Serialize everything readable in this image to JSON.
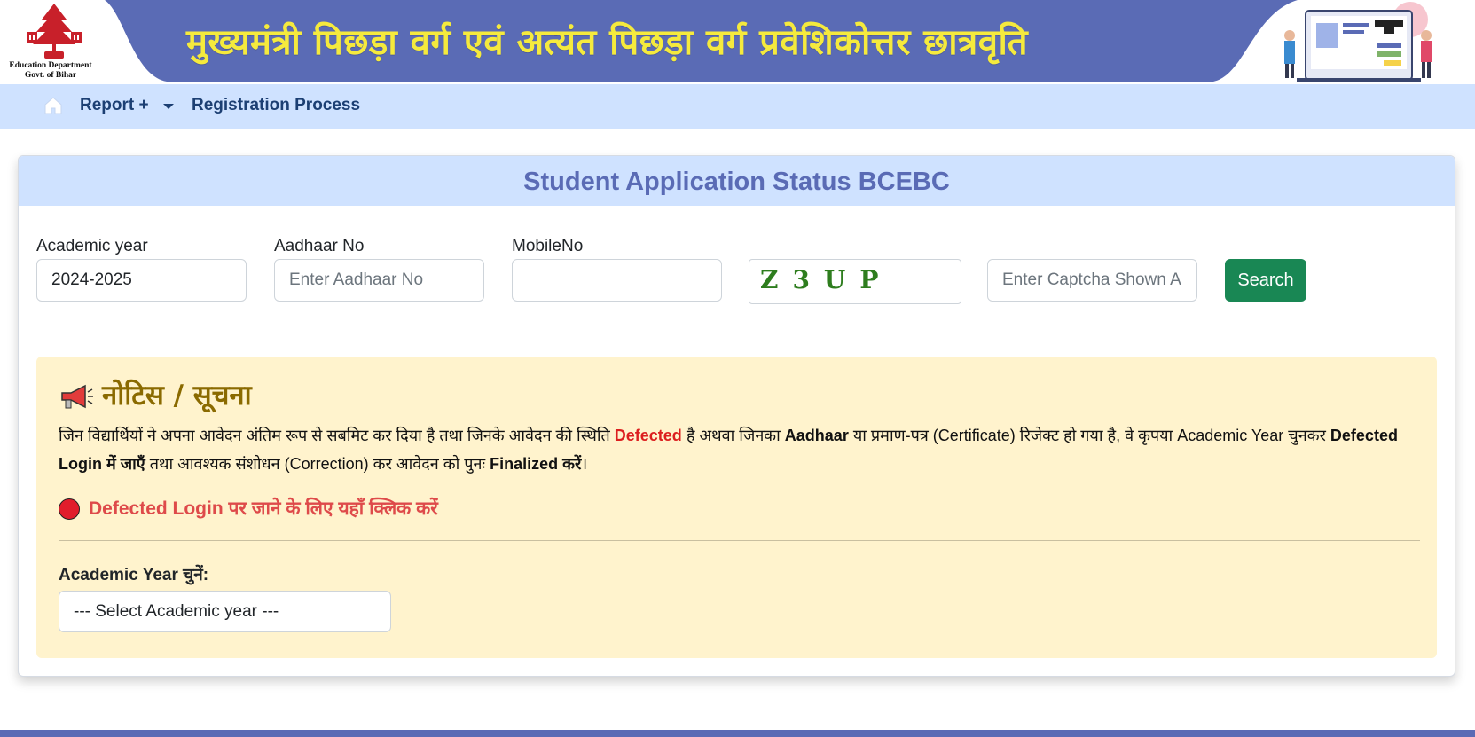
{
  "header": {
    "title": "मुख्यमंत्री पिछड़ा वर्ग एवं अत्यंत पिछड़ा वर्ग प्रवेशिकोत्तर छात्रवृति",
    "logo_line1": "Education Department",
    "logo_line2": "Govt. of Bihar",
    "band_color": "#5a6bb5",
    "title_color": "#f5ea3d"
  },
  "nav": {
    "home_icon": "home-icon",
    "report_label": "Report +",
    "registration_label": "Registration Process"
  },
  "card": {
    "title": "Student Application Status BCEBC",
    "academic_year": {
      "label": "Academic year",
      "value": "2024-2025"
    },
    "aadhaar": {
      "label": "Aadhaar No",
      "placeholder": "Enter Aadhaar No"
    },
    "mobile": {
      "label": "MobileNo",
      "value": ""
    },
    "captcha_text": "Z3UP",
    "captcha_input": {
      "placeholder": "Enter Captcha Shown A"
    },
    "search_label": "Search"
  },
  "notice": {
    "icon": "megaphone-icon",
    "title": "नोटिस / सूचना",
    "line_part1": "जिन विद्यार्थियों ने अपना आवेदन अंतिम रूप से सबमिट कर दिया है तथा जिनके आवेदन की स्थिति ",
    "defected": "Defected",
    "line_part2": " है अथवा जिनका ",
    "aadhaar_word": "Aadhaar",
    "line_part3": " या प्रमाण-पत्र (Certificate) रिजेक्ट हो गया है, वे कृपया Academic Year चुनकर ",
    "defected_login_bold": "Defected Login में जाएँ",
    "line_part4": " तथा आवश्यक संशोधन (Correction) कर आवेदन को पुनः ",
    "finalized_bold": "Finalized करें",
    "line_end": "।",
    "link_text": "Defected Login पर जाने के लिए यहाँ क्लिक करें",
    "academic_year_label": "Academic Year चुनें:",
    "select_placeholder": "--- Select Academic year ---"
  }
}
